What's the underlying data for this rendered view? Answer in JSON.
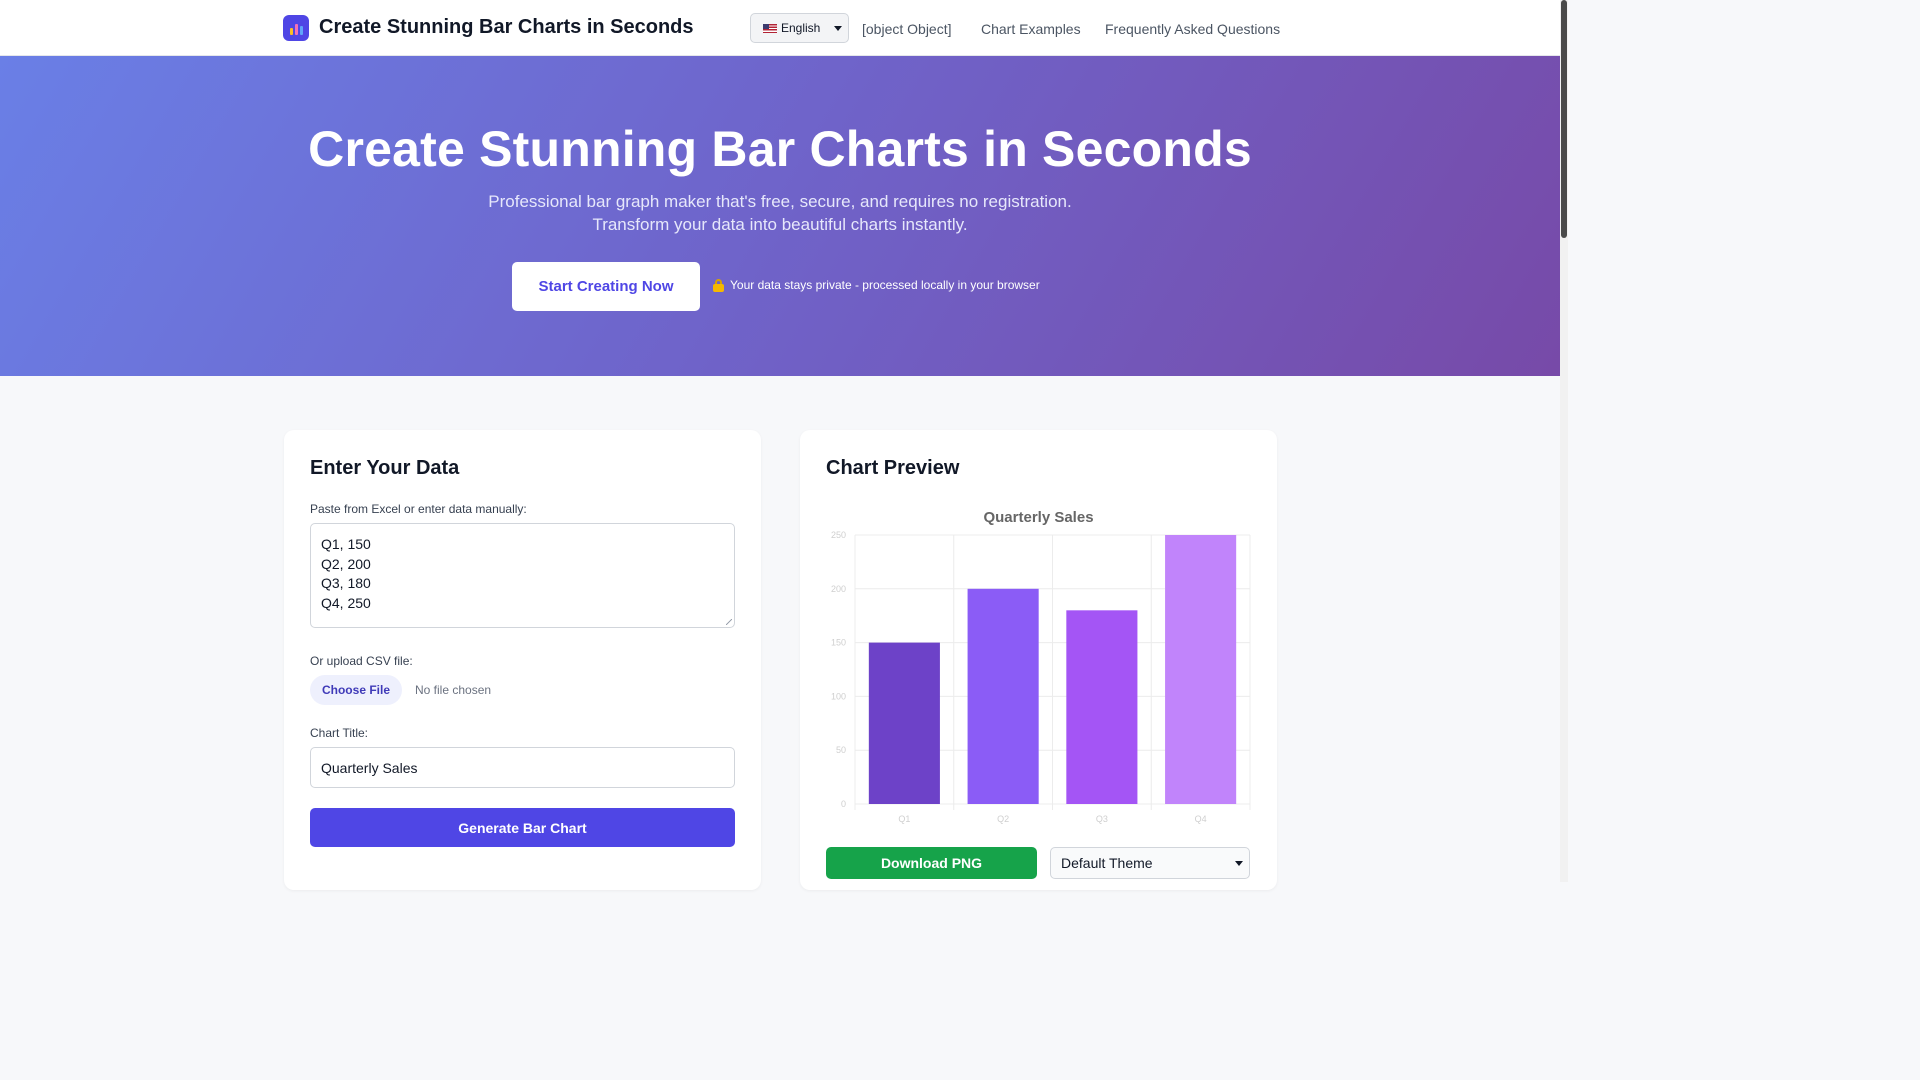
{
  "header": {
    "brand": "Create Stunning Bar Charts in Seconds",
    "language": "English",
    "nav": [
      "[object Object]",
      "Chart Examples",
      "Frequently Asked Questions"
    ]
  },
  "hero": {
    "title": "Create Stunning Bar Charts in Seconds",
    "subtitle_line1": "Professional bar graph maker that's free, secure, and requires no registration.",
    "subtitle_line2": "Transform your data into beautiful charts instantly.",
    "cta": "Start Creating Now",
    "privacy": "Your data stays private - processed locally in your browser"
  },
  "input_card": {
    "heading": "Enter Your Data",
    "paste_label": "Paste from Excel or enter data manually:",
    "data_lines": [
      "Q1, 150",
      "Q2, 200",
      "Q3, 180",
      "Q4, 250"
    ],
    "upload_label": "Or upload CSV file:",
    "choose_file": "Choose File",
    "no_file": "No file chosen",
    "title_label": "Chart Title:",
    "title_value": "Quarterly Sales",
    "generate": "Generate Bar Chart"
  },
  "preview_card": {
    "heading": "Chart Preview",
    "download": "Download PNG",
    "theme": "Default Theme"
  },
  "chart_data": {
    "type": "bar",
    "title": "Quarterly Sales",
    "categories": [
      "Q1",
      "Q2",
      "Q3",
      "Q4"
    ],
    "values": [
      150,
      200,
      180,
      250
    ],
    "ylim": [
      0,
      250
    ],
    "yticks": [
      0,
      50,
      100,
      150,
      200,
      250
    ],
    "grid": true,
    "colors": [
      "#6d42c8",
      "#8b5cf6",
      "#a455f5",
      "#c184fb"
    ]
  },
  "colors": {
    "accent": "#4f46e5",
    "download": "#16a34a"
  }
}
